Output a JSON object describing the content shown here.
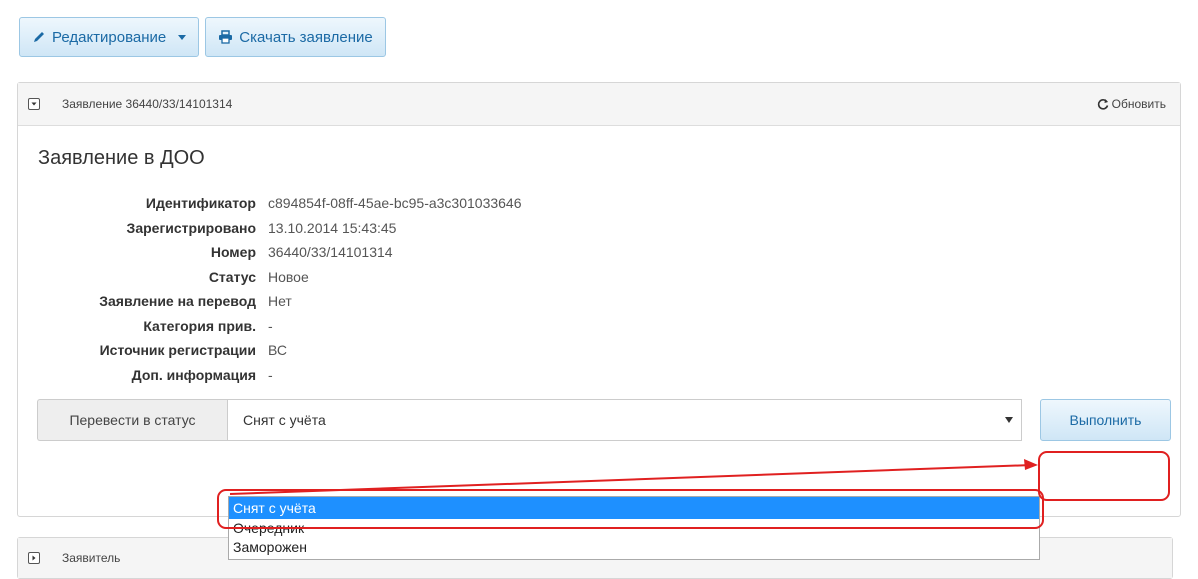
{
  "toolbar": {
    "edit_label": "Редактирование",
    "download_label": "Скачать заявление"
  },
  "application_panel": {
    "header_title": "Заявление 36440/33/14101314",
    "refresh_label": "Обновить",
    "title": "Заявление в ДОО",
    "fields": [
      {
        "label": "Идентификатор",
        "value": "c894854f-08ff-45ae-bc95-a3c301033646"
      },
      {
        "label": "Зарегистрировано",
        "value": "13.10.2014 15:43:45"
      },
      {
        "label": "Номер",
        "value": "36440/33/14101314"
      },
      {
        "label": "Статус",
        "value": "Новое"
      },
      {
        "label": "Заявление на перевод",
        "value": "Нет"
      },
      {
        "label": "Категория прив.",
        "value": "-"
      },
      {
        "label": "Источник регистрации",
        "value": "ВС"
      },
      {
        "label": "Доп. информация",
        "value": "-"
      }
    ]
  },
  "status_change": {
    "addon_label": "Перевести в статус",
    "selected": "Снят с учёта",
    "options": [
      "Снят с учёта",
      "Очередник",
      "Заморожен"
    ],
    "execute_label": "Выполнить"
  },
  "applicant_panel": {
    "header_title": "Заявитель"
  },
  "colors": {
    "accent": "#1b6aa5",
    "highlight": "#1e90ff",
    "annotation": "#e02020"
  }
}
